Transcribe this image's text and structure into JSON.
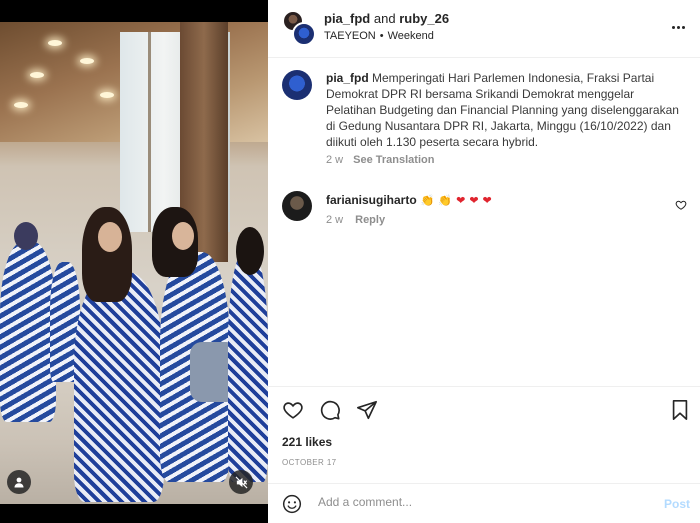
{
  "post": {
    "header": {
      "author": "pia_fpd",
      "joiner": "and",
      "collaborator": "ruby_26",
      "audio_artist": "TAEYEON",
      "separator": "•",
      "audio_title": "Weekend",
      "menu_icon": "more-horizontal-icon"
    },
    "caption": {
      "username": "pia_fpd",
      "text": "Memperingati Hari Parlemen Indonesia, Fraksi Partai Demokrat DPR RI bersama Srikandi Demokrat menggelar Pelatihan Budgeting dan Financial Planning yang diselenggarakan di Gedung Nusantara DPR RI, Jakarta, Minggu (16/10/2022) dan diikuti oleh 1.130 peserta secara hybrid.",
      "age": "2 w",
      "translation_link": "See Translation"
    },
    "comments": [
      {
        "username": "farianisugiharto",
        "emojis": [
          "👏",
          "👏",
          "❤",
          "❤",
          "❤"
        ],
        "age": "2 w",
        "reply_label": "Reply"
      }
    ],
    "actions": {
      "like_icon": "heart-icon",
      "comment_icon": "comment-icon",
      "share_icon": "send-icon",
      "save_icon": "bookmark-icon"
    },
    "likes": "221 likes",
    "date": "OCTOBER 17",
    "add_comment": {
      "placeholder": "Add a comment...",
      "post_label": "Post"
    },
    "media": {
      "tag_icon": "user-tag-icon",
      "mute_icon": "muted-speaker-icon"
    },
    "colors": {
      "accent_post_disabled": "#b3dbff",
      "heart_red": "#ed4956",
      "secondary_text": "#8e8e8e"
    }
  }
}
